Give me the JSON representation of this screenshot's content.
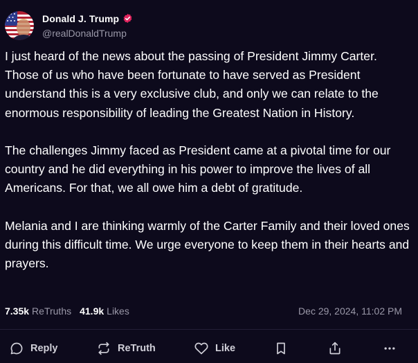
{
  "user": {
    "display_name": "Donald J. Trump",
    "handle": "@realDonaldTrump",
    "avatar_icon": "flag-portrait-avatar",
    "verified_icon": "verified-badge-icon",
    "verified_color": "#e0245e"
  },
  "post": {
    "paragraphs": [
      "I just heard of the news about the passing of President Jimmy Carter. Those of us who have been fortunate to have served as President understand this is a very exclusive club, and only we can relate to the enormous responsibility of leading the Greatest Nation in History.",
      "The challenges Jimmy faced as President came at a pivotal time for our country and he did everything in his power to improve the lives of all Americans. For that, we all owe him a debt of gratitude.",
      "Melania and I are thinking warmly of the Carter Family and their loved ones during this difficult time. We urge everyone to keep them in their hearts and prayers."
    ],
    "retruths_count": "7.35k",
    "retruths_label": "ReTruths",
    "likes_count": "41.9k",
    "likes_label": "Likes",
    "timestamp": "Dec 29, 2024, 11:02 PM"
  },
  "actions": {
    "reply_label": "Reply",
    "retruth_label": "ReTruth",
    "like_label": "Like"
  },
  "colors": {
    "background": "#0d0a1c",
    "muted_text": "#9a98a8",
    "action_text": "#d0cfd8"
  }
}
